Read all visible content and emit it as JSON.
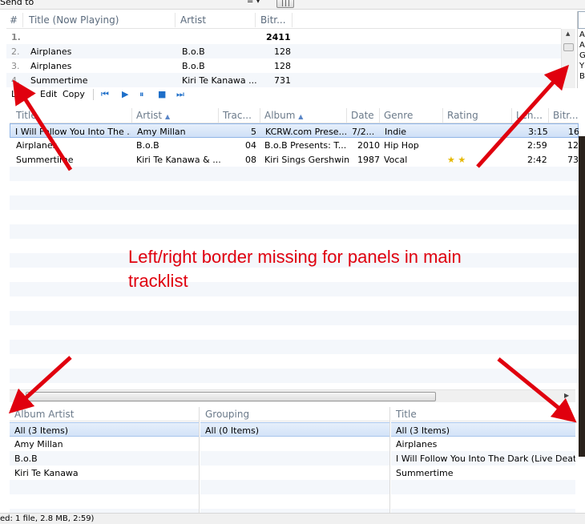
{
  "topbar": {
    "send_to": "Send to",
    "view_icon": "≡ ▾"
  },
  "now_playing": {
    "headers": {
      "index": "#",
      "title": "Title (Now Playing)",
      "artist": "Artist",
      "bitrate": "Bitr..."
    },
    "rows": [
      {
        "index": "1.",
        "title": "",
        "artist": "",
        "bitrate": "2411",
        "bold": true
      },
      {
        "index": "2.",
        "title": "Airplanes",
        "artist": "B.o.B",
        "bitrate": "128"
      },
      {
        "index": "3.",
        "title": "Airplanes",
        "artist": "B.o.B",
        "bitrate": "128"
      },
      {
        "index": "4.",
        "title": "Summertime",
        "artist": "Kiri Te Kanawa ...",
        "bitrate": "731"
      }
    ],
    "side_letters": [
      "A",
      "A",
      "G",
      "Y",
      "B"
    ]
  },
  "toolbar": {
    "list": "List",
    "edit": "Edit",
    "copy": "Copy",
    "prev": "⏮",
    "play": "▶",
    "pause": "⏸",
    "stop": "■",
    "next": "⏭"
  },
  "tracklist": {
    "headers": {
      "title": "Title",
      "artist": "Artist",
      "track": "Trac...",
      "album": "Album",
      "date": "Date",
      "genre": "Genre",
      "rating": "Rating",
      "length": "Len...",
      "bitrate": "Bitr..."
    },
    "rows": [
      {
        "title": "I Will Follow You Into The ...",
        "artist": "Amy Millan",
        "track": "5",
        "album": "KCRW.com Prese...",
        "date": "7/2...",
        "genre": "Indie",
        "rating": "",
        "length": "3:15",
        "bitrate": "16",
        "selected": true
      },
      {
        "title": "Airplanes",
        "artist": "B.o.B",
        "track": "04",
        "album": "B.o.B Presents: T...",
        "date": "2010",
        "genre": "Hip Hop",
        "rating": "",
        "length": "2:59",
        "bitrate": "12"
      },
      {
        "title": "Summertime",
        "artist": "Kiri Te Kanawa & ...",
        "track": "08",
        "album": "Kiri Sings Gershwin",
        "date": "1987",
        "genre": "Vocal",
        "rating": "★ ★",
        "length": "2:42",
        "bitrate": "73"
      }
    ]
  },
  "filters": {
    "album_artist": {
      "header": "Album Artist",
      "items": [
        "All (3 Items)",
        "Amy Millan",
        "B.o.B",
        "Kiri Te Kanawa"
      ]
    },
    "grouping": {
      "header": "Grouping",
      "items": [
        "All (0 Items)"
      ]
    },
    "title": {
      "header": "Title",
      "items": [
        "All (3 Items)",
        "Airplanes",
        "I Will Follow You Into The Dark (Live Death C...",
        "Summertime"
      ]
    }
  },
  "status": {
    "text": "ed: 1 file, 2.8 MB, 2:59)"
  },
  "annotation": {
    "line1": "Left/right border missing for panels in main",
    "line2": "tracklist"
  },
  "colors": {
    "annotation": "#e0000e",
    "selection": "#cfe0f7",
    "header_text": "#6b7a8a"
  }
}
